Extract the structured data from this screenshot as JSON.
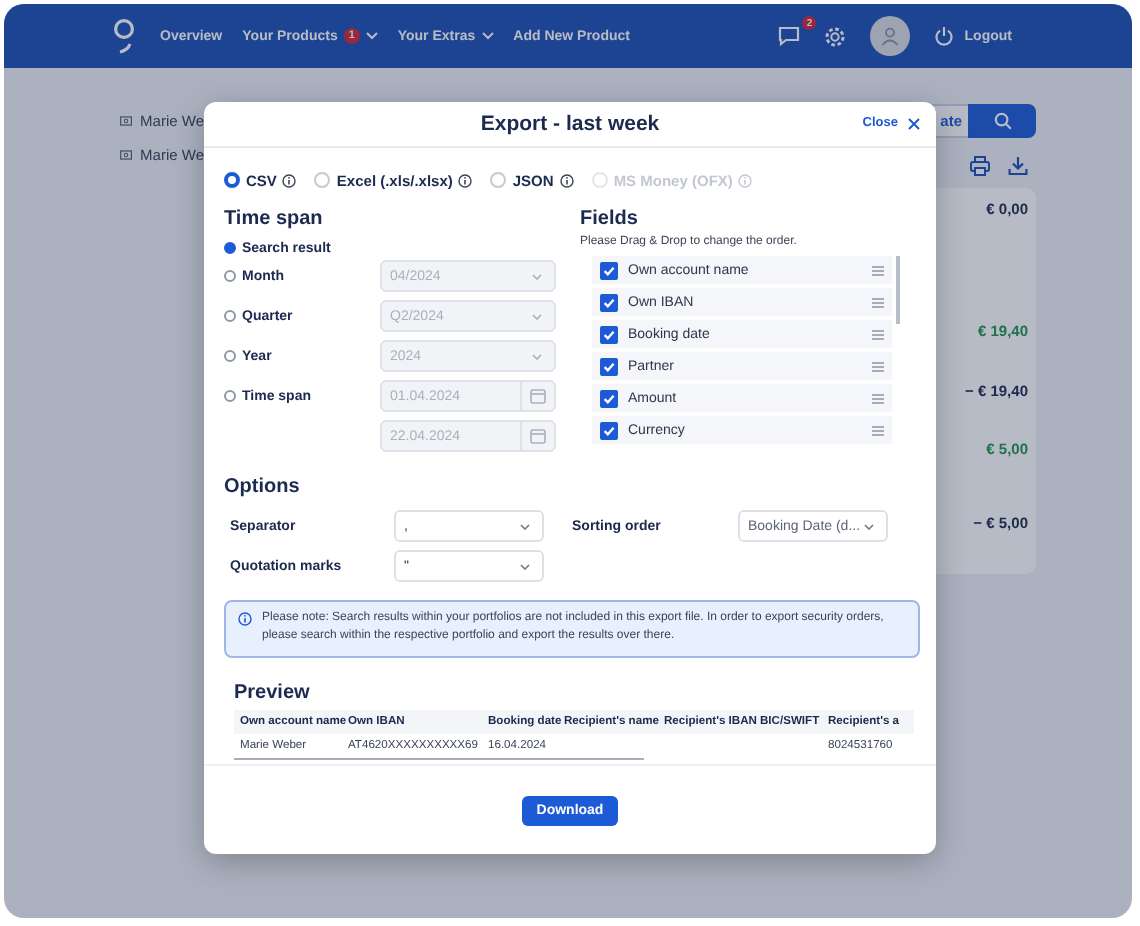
{
  "header": {
    "nav": [
      {
        "label": "Overview",
        "dropdown": false
      },
      {
        "label": "Your Products",
        "badge": "1",
        "dropdown": true
      },
      {
        "label": "Your Extras",
        "dropdown": true
      },
      {
        "label": "Add New Product",
        "dropdown": false
      }
    ],
    "messages_badge": "2",
    "logout": "Logout"
  },
  "background": {
    "accounts": [
      {
        "name": "Marie We"
      },
      {
        "name": "Marie We"
      }
    ],
    "update_button": "ate",
    "amounts": [
      {
        "value": "€ 0,00",
        "credit": false
      },
      {
        "value": "€ 19,40",
        "credit": true
      },
      {
        "value": "− € 19,40",
        "credit": false
      },
      {
        "value": "€ 5,00",
        "credit": true
      },
      {
        "value": "− € 5,00",
        "credit": false
      }
    ]
  },
  "modal": {
    "title": "Export - last week",
    "close": "Close",
    "formats": [
      {
        "label": "CSV",
        "selected": true,
        "disabled": false
      },
      {
        "label": "Excel (.xls/.xlsx)",
        "selected": false,
        "disabled": false
      },
      {
        "label": "JSON",
        "selected": false,
        "disabled": false
      },
      {
        "label": "MS Money (OFX)",
        "selected": false,
        "disabled": true
      }
    ],
    "time_span": {
      "title": "Time span",
      "options": [
        {
          "label": "Search result",
          "selected": true
        },
        {
          "label": "Month",
          "selected": false,
          "fields": [
            {
              "kind": "select",
              "value": "04/2024",
              "disabled": true
            }
          ]
        },
        {
          "label": "Quarter",
          "selected": false,
          "fields": [
            {
              "kind": "select",
              "value": "Q2/2024",
              "disabled": true
            }
          ]
        },
        {
          "label": "Year",
          "selected": false,
          "fields": [
            {
              "kind": "select",
              "value": "2024",
              "disabled": true
            }
          ]
        },
        {
          "label": "Time span",
          "selected": false,
          "fields": [
            {
              "kind": "date",
              "value": "01.04.2024",
              "disabled": true
            },
            {
              "kind": "date",
              "value": "22.04.2024",
              "disabled": true
            }
          ]
        }
      ]
    },
    "fields": {
      "title": "Fields",
      "hint": "Please Drag & Drop to change the order.",
      "items": [
        {
          "label": "Own account name",
          "checked": true
        },
        {
          "label": "Own IBAN",
          "checked": true
        },
        {
          "label": "Booking date",
          "checked": true
        },
        {
          "label": "Partner",
          "checked": true
        },
        {
          "label": "Amount",
          "checked": true
        },
        {
          "label": "Currency",
          "checked": true
        }
      ]
    },
    "options": {
      "title": "Options",
      "separator": {
        "label": "Separator",
        "value": ","
      },
      "quotation": {
        "label": "Quotation marks",
        "value": "\""
      },
      "sorting": {
        "label": "Sorting order",
        "value": "Booking Date (d..."
      }
    },
    "note": "Please note: Search results within your portfolios are not included in this export file. In order to export security orders, please search within the respective portfolio and export the results over there.",
    "preview": {
      "title": "Preview",
      "columns": [
        {
          "label": "Own account name",
          "value": "Marie Weber"
        },
        {
          "label": "Own IBAN",
          "value": "AT4620XXXXXXXXXX69"
        },
        {
          "label": "Booking date",
          "value": "16.04.2024"
        },
        {
          "label": "Recipient's name"
        },
        {
          "label": "Recipient's IBAN"
        },
        {
          "label": "BIC/SWIFT"
        },
        {
          "label": "Recipient's a",
          "value": "8024531760"
        }
      ]
    },
    "download": "Download"
  }
}
